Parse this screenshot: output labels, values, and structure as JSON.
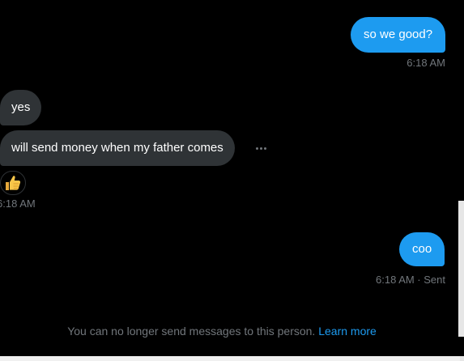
{
  "messages": [
    {
      "direction": "outgoing",
      "text": "so we good?"
    },
    {
      "direction": "incoming",
      "text": "yes"
    },
    {
      "direction": "incoming",
      "text": "will send money when my father comes"
    },
    {
      "direction": "outgoing",
      "text": "coo"
    }
  ],
  "timestamps": {
    "group1": "6:18 AM",
    "group2": "6:18 AM",
    "group3": "6:18 AM · Sent"
  },
  "reaction": {
    "emoji": "thumbs-up-icon"
  },
  "footer": {
    "notice": "You can no longer send messages to this person.",
    "link": "Learn more"
  },
  "colors": {
    "background": "#000000",
    "outgoing_bubble": "#1d9bf0",
    "incoming_bubble": "#2f3336",
    "secondary_text": "#71767b",
    "link": "#1d9bf0"
  }
}
